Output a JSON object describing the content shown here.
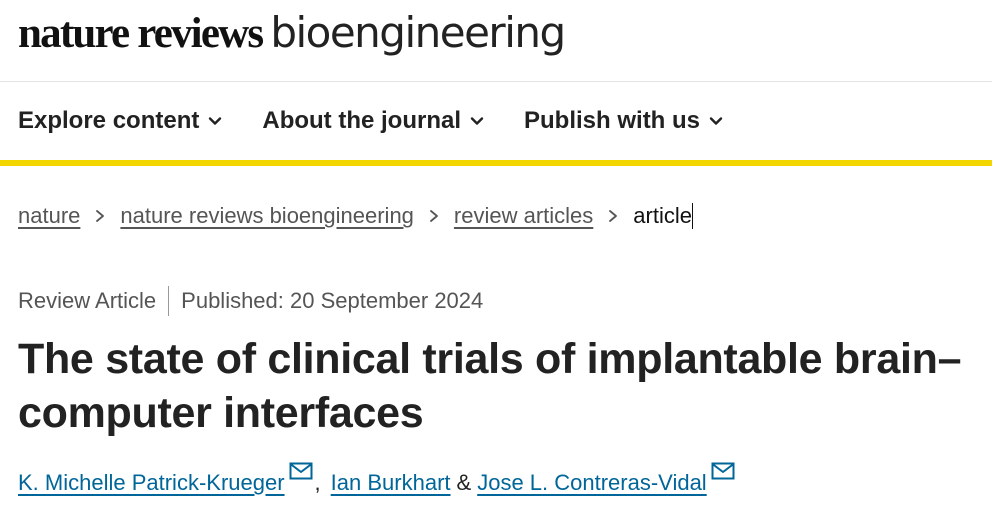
{
  "header": {
    "brand_nature": "nature reviews",
    "brand_journal": "bioengineering"
  },
  "nav": {
    "items": [
      {
        "label": "Explore content"
      },
      {
        "label": "About the journal"
      },
      {
        "label": "Publish with us"
      }
    ]
  },
  "breadcrumb": {
    "items": [
      {
        "label": "nature"
      },
      {
        "label": "nature reviews bioengineering"
      },
      {
        "label": "review articles"
      }
    ],
    "current": "article"
  },
  "article": {
    "type": "Review Article",
    "published": "Published: 20 September 2024",
    "title_line1": "The state of clinical trials of implantable brain–",
    "title_line2": "computer interfaces",
    "authors": [
      {
        "name": "K. Michelle Patrick-Krueger"
      },
      {
        "name": "Ian Burkhart"
      },
      {
        "name": "Jose L. Contreras-Vidal"
      }
    ],
    "author_sep_comma": ",",
    "author_sep_and": "&"
  },
  "colors": {
    "accent_bar": "#f2d600",
    "link": "#006699"
  },
  "icons": {
    "nav_chevron": "chevron-down-icon",
    "breadcrumb_separator": "chevron-right-icon",
    "author_contact": "mail-icon"
  }
}
